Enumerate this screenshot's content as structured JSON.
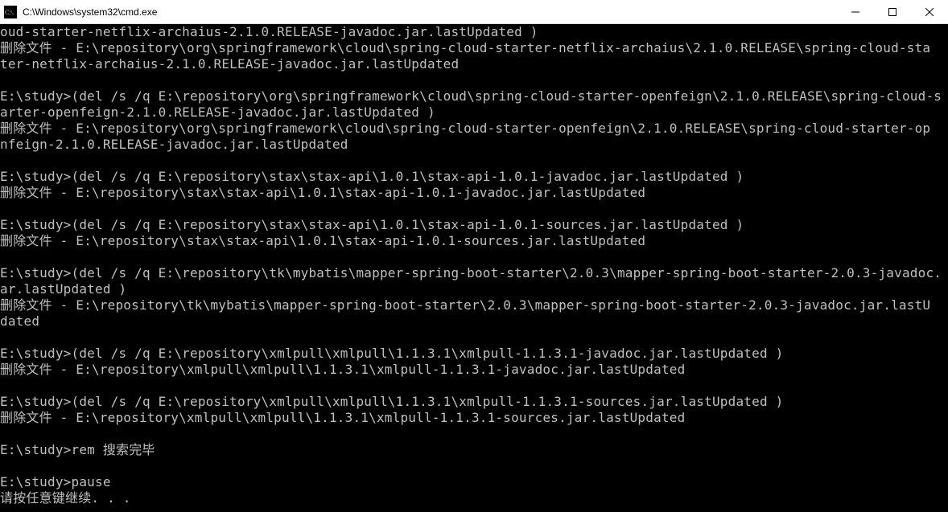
{
  "window": {
    "title": "C:\\Windows\\system32\\cmd.exe",
    "icon_label": "C:\\."
  },
  "terminal": {
    "lines": [
      "oud-starter-netflix-archaius-2.1.0.RELEASE-javadoc.jar.lastUpdated )",
      "删除文件 - E:\\repository\\org\\springframework\\cloud\\spring-cloud-starter-netflix-archaius\\2.1.0.RELEASE\\spring-cloud-sta",
      "ter-netflix-archaius-2.1.0.RELEASE-javadoc.jar.lastUpdated",
      "",
      "E:\\study>(del /s /q E:\\repository\\org\\springframework\\cloud\\spring-cloud-starter-openfeign\\2.1.0.RELEASE\\spring-cloud-s",
      "arter-openfeign-2.1.0.RELEASE-javadoc.jar.lastUpdated )",
      "删除文件 - E:\\repository\\org\\springframework\\cloud\\spring-cloud-starter-openfeign\\2.1.0.RELEASE\\spring-cloud-starter-op",
      "nfeign-2.1.0.RELEASE-javadoc.jar.lastUpdated",
      "",
      "E:\\study>(del /s /q E:\\repository\\stax\\stax-api\\1.0.1\\stax-api-1.0.1-javadoc.jar.lastUpdated )",
      "删除文件 - E:\\repository\\stax\\stax-api\\1.0.1\\stax-api-1.0.1-javadoc.jar.lastUpdated",
      "",
      "E:\\study>(del /s /q E:\\repository\\stax\\stax-api\\1.0.1\\stax-api-1.0.1-sources.jar.lastUpdated )",
      "删除文件 - E:\\repository\\stax\\stax-api\\1.0.1\\stax-api-1.0.1-sources.jar.lastUpdated",
      "",
      "E:\\study>(del /s /q E:\\repository\\tk\\mybatis\\mapper-spring-boot-starter\\2.0.3\\mapper-spring-boot-starter-2.0.3-javadoc.",
      "ar.lastUpdated )",
      "删除文件 - E:\\repository\\tk\\mybatis\\mapper-spring-boot-starter\\2.0.3\\mapper-spring-boot-starter-2.0.3-javadoc.jar.lastU",
      "dated",
      "",
      "E:\\study>(del /s /q E:\\repository\\xmlpull\\xmlpull\\1.1.3.1\\xmlpull-1.1.3.1-javadoc.jar.lastUpdated )",
      "删除文件 - E:\\repository\\xmlpull\\xmlpull\\1.1.3.1\\xmlpull-1.1.3.1-javadoc.jar.lastUpdated",
      "",
      "E:\\study>(del /s /q E:\\repository\\xmlpull\\xmlpull\\1.1.3.1\\xmlpull-1.1.3.1-sources.jar.lastUpdated )",
      "删除文件 - E:\\repository\\xmlpull\\xmlpull\\1.1.3.1\\xmlpull-1.1.3.1-sources.jar.lastUpdated",
      "",
      "E:\\study>rem 搜索完毕",
      "",
      "E:\\study>pause",
      "请按任意键继续. . ."
    ]
  }
}
